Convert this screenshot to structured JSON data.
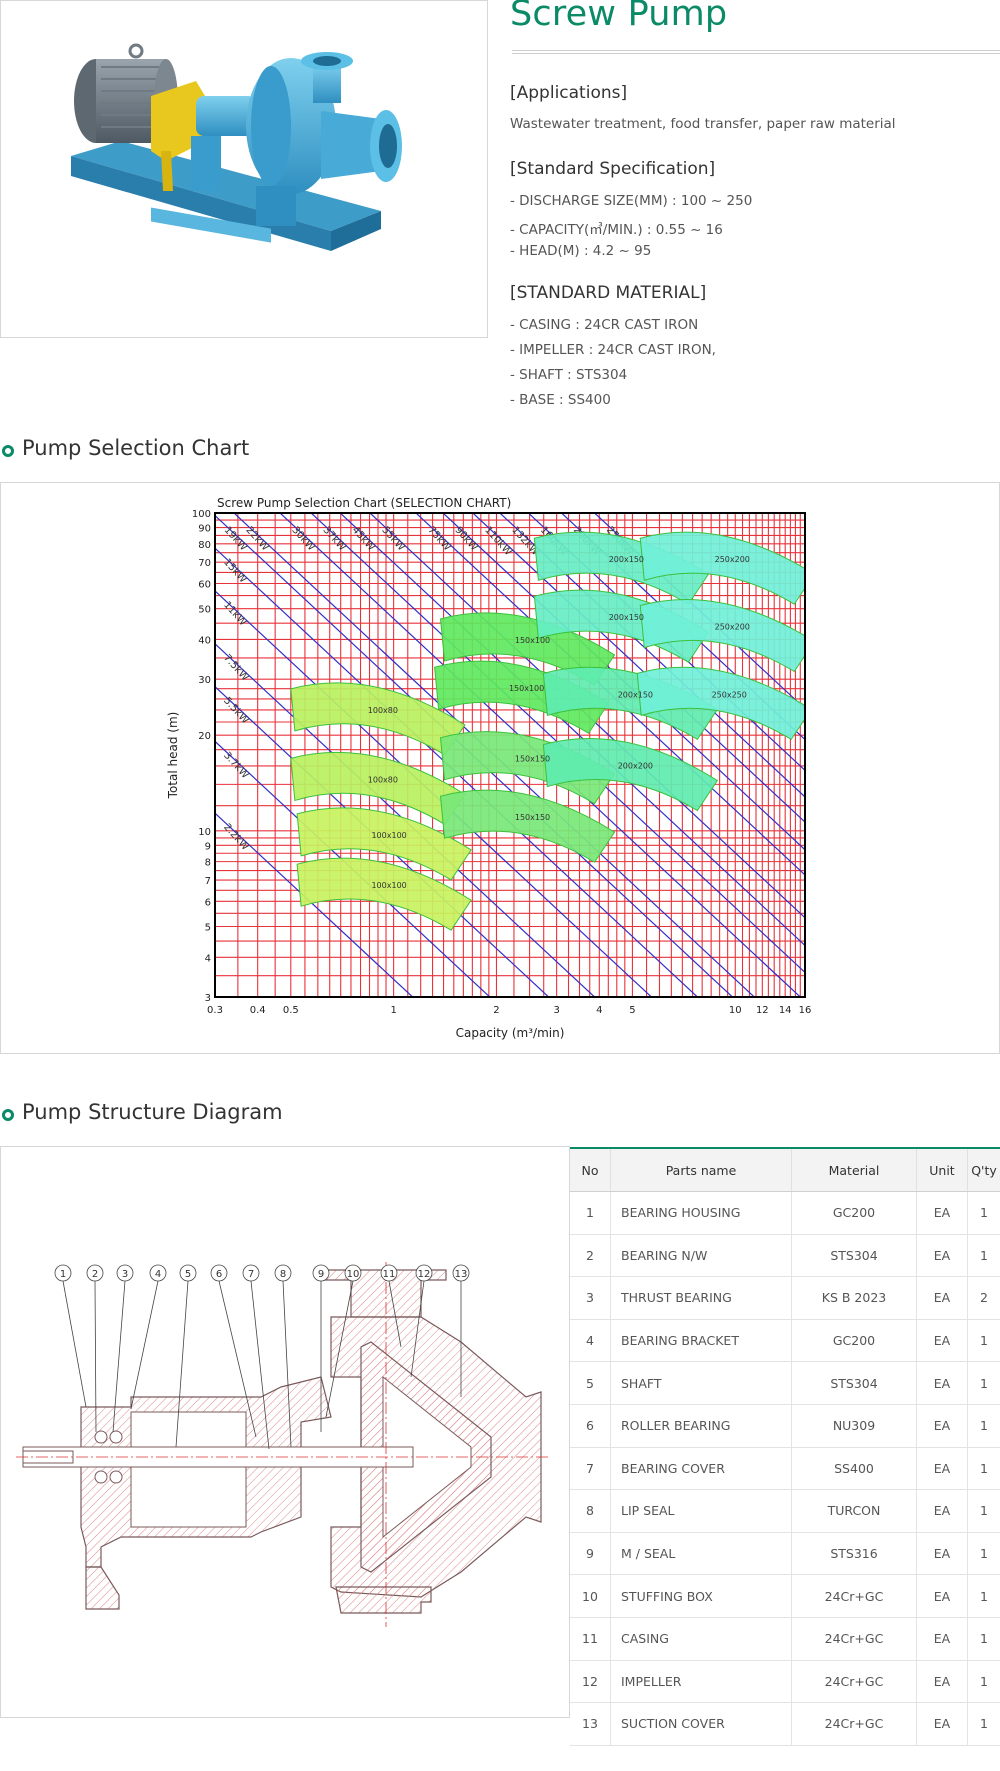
{
  "product": {
    "title": "Screw Pump",
    "applications_heading": "[Applications]",
    "applications_text": "Wastewater treatment, food transfer, paper raw material",
    "spec_heading": "[Standard Specification]",
    "spec_items": [
      "- DISCHARGE SIZE(MM) : 100 ~ 250",
      "- CAPACITY(㎥/MIN.) : 0.55 ~ 16",
      "- HEAD(M) : 4.2 ~ 95"
    ],
    "material_heading": "[STANDARD MATERIAL]",
    "material_items": [
      "- CASING : 24CR CAST IRON",
      "- IMPELLER : 24CR CAST IRON,",
      "- SHAFT : STS304",
      "- BASE : SS400"
    ]
  },
  "sections": {
    "selection_chart": "Pump Selection Chart",
    "structure_diagram": "Pump Structure Diagram"
  },
  "colors": {
    "accent": "#0a8a66",
    "grid_red": "#e8323a",
    "power_blue": "#3030c8",
    "pump_body": "#4fb2d8"
  },
  "chart_data": {
    "type": "scatter",
    "title": "Screw Pump Selection Chart (SELECTION CHART)",
    "xlabel": "Capacity (m³/min)",
    "ylabel": "Total head (m)",
    "xscale": "log",
    "yscale": "log",
    "xlim": [
      0.3,
      16
    ],
    "ylim": [
      3,
      100
    ],
    "x_ticks": [
      0.3,
      0.4,
      0.5,
      1,
      2,
      3,
      4,
      5,
      10,
      12,
      14,
      16
    ],
    "x_tick_labels": [
      "0.3",
      "0.4",
      "0.5",
      "1",
      "2",
      "3",
      "4",
      "5",
      "10",
      "12",
      "14",
      "16"
    ],
    "y_ticks": [
      3,
      4,
      5,
      6,
      7,
      8,
      9,
      10,
      20,
      30,
      40,
      50,
      60,
      70,
      80,
      90,
      100
    ],
    "y_tick_labels": [
      "3",
      "4",
      "5",
      "6",
      "7",
      "8",
      "9",
      "10",
      "20",
      "30",
      "40",
      "50",
      "60",
      "70",
      "80",
      "90",
      "100"
    ],
    "grid": true,
    "power_lines": [
      "2.2kW",
      "3.7kW",
      "5.5kW",
      "7.5kW",
      "11kW",
      "15kW",
      "19kW",
      "22kW",
      "30kW",
      "37kW",
      "45kW",
      "55kW",
      "75kW",
      "90kW",
      "110kW",
      "132kW",
      "160kW",
      "200kW",
      "250kW"
    ],
    "regions": [
      {
        "label": "100x100",
        "x": 0.97,
        "y": 6.6,
        "color": "#c8f260"
      },
      {
        "label": "100x100",
        "x": 0.97,
        "y": 9.5,
        "color": "#c8f260"
      },
      {
        "label": "100x80",
        "x": 0.93,
        "y": 14.2,
        "color": "#b8f060"
      },
      {
        "label": "100x80",
        "x": 0.93,
        "y": 23.5,
        "color": "#b8f060"
      },
      {
        "label": "150x150",
        "x": 2.55,
        "y": 10.8,
        "color": "#78e878"
      },
      {
        "label": "150x150",
        "x": 2.55,
        "y": 16.5,
        "color": "#78e878"
      },
      {
        "label": "150x100",
        "x": 2.45,
        "y": 27.5,
        "color": "#5ee85e"
      },
      {
        "label": "150x100",
        "x": 2.55,
        "y": 39,
        "color": "#5ee85e"
      },
      {
        "label": "200x200",
        "x": 5.1,
        "y": 15.7,
        "color": "#60ecb0"
      },
      {
        "label": "200x150",
        "x": 5.1,
        "y": 26.3,
        "color": "#60ecb0"
      },
      {
        "label": "200x150",
        "x": 4.8,
        "y": 46,
        "color": "#66eec4"
      },
      {
        "label": "200x150",
        "x": 4.8,
        "y": 70,
        "color": "#66eec4"
      },
      {
        "label": "250x250",
        "x": 9.6,
        "y": 26.3,
        "color": "#70f0d8"
      },
      {
        "label": "250x200",
        "x": 9.8,
        "y": 43,
        "color": "#70f0d8"
      },
      {
        "label": "250x200",
        "x": 9.8,
        "y": 70,
        "color": "#70f0d8"
      }
    ]
  },
  "diagram": {
    "callouts": [
      "1",
      "2",
      "3",
      "4",
      "5",
      "6",
      "7",
      "8",
      "9",
      "10",
      "11",
      "12",
      "13"
    ]
  },
  "parts_table": {
    "headers": [
      "No",
      "Parts name",
      "Material",
      "Unit",
      "Q'ty"
    ],
    "rows": [
      [
        "1",
        "BEARING HOUSING",
        "GC200",
        "EA",
        "1"
      ],
      [
        "2",
        "BEARING N/W",
        "STS304",
        "EA",
        "1"
      ],
      [
        "3",
        "THRUST BEARING",
        "KS B 2023",
        "EA",
        "2"
      ],
      [
        "4",
        "BEARING BRACKET",
        "GC200",
        "EA",
        "1"
      ],
      [
        "5",
        "SHAFT",
        "STS304",
        "EA",
        "1"
      ],
      [
        "6",
        "ROLLER BEARING",
        "NU309",
        "EA",
        "1"
      ],
      [
        "7",
        "BEARING COVER",
        "SS400",
        "EA",
        "1"
      ],
      [
        "8",
        "LIP SEAL",
        "TURCON",
        "EA",
        "1"
      ],
      [
        "9",
        "M / SEAL",
        "STS316",
        "EA",
        "1"
      ],
      [
        "10",
        "STUFFING BOX",
        "24Cr+GC",
        "EA",
        "1"
      ],
      [
        "11",
        "CASING",
        "24Cr+GC",
        "EA",
        "1"
      ],
      [
        "12",
        "IMPELLER",
        "24Cr+GC",
        "EA",
        "1"
      ],
      [
        "13",
        "SUCTION COVER",
        "24Cr+GC",
        "EA",
        "1"
      ]
    ]
  }
}
